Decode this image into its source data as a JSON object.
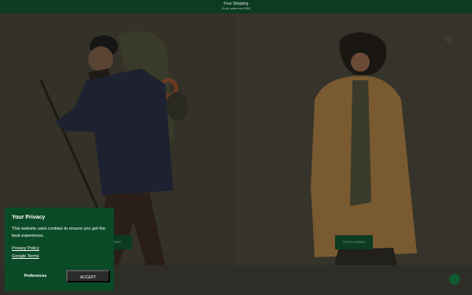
{
  "promo": {
    "title": "Free Shipping",
    "subtitle": "On all orders over $250"
  },
  "hero": {
    "left": {
      "cta": "SHOP MEN"
    },
    "right": {
      "cta": "SHOP WOMEN"
    }
  },
  "cookie": {
    "title": "Your Privacy",
    "body": "This website uses cookies to ensure you get the best experience.",
    "privacy_link": "Privacy Policy",
    "terms_link": "Google Terms",
    "preferences_label": "Preferences",
    "accept_label": "ACCEPT"
  },
  "colors": {
    "brand_green": "#0b4a26",
    "promo_green": "#0b3b22",
    "overlay": "#2a2924"
  },
  "icons": {
    "search": "search-icon",
    "chat": "chat-icon"
  }
}
